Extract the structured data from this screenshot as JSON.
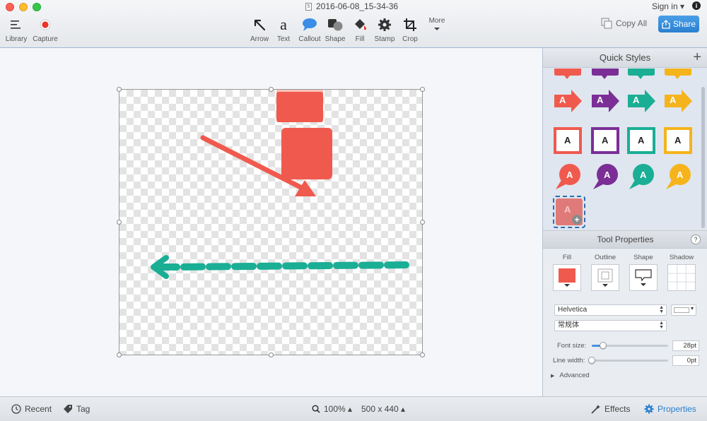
{
  "window": {
    "title": "2016-06-08_15-34-36",
    "signin": "Sign in ▾",
    "doc_glyph": "5"
  },
  "toolbar": {
    "library": "Library",
    "capture": "Capture",
    "tools": {
      "arrow": "Arrow",
      "text": "Text",
      "text_glyph": "a",
      "callout": "Callout",
      "shape": "Shape",
      "fill": "Fill",
      "stamp": "Stamp",
      "crop": "Crop",
      "more": "More"
    },
    "copy_all": "Copy All",
    "share": "Share"
  },
  "quick_styles": {
    "title": "Quick Styles",
    "letter": "A",
    "colors": [
      "#f05a4e",
      "#7b2e96",
      "#1aae95",
      "#f5b41c"
    ]
  },
  "tool_properties": {
    "title": "Tool Properties",
    "help": "?",
    "fill_label": "Fill",
    "outline_label": "Outline",
    "shape_label": "Shape",
    "shadow_label": "Shadow",
    "fill_color": "#f05a4e",
    "font_family": "Helvetica",
    "font_style": "常规体",
    "font_size_label": "Font size:",
    "font_size_value": "28pt",
    "font_size_level": 0.15,
    "line_width_label": "Line width:",
    "line_width_value": "0pt",
    "line_width_level": 0,
    "advanced": "Advanced"
  },
  "bottom": {
    "recent": "Recent",
    "tag": "Tag",
    "zoom": "100% ▴",
    "dimensions": "500 x 440 ▴",
    "effects": "Effects",
    "properties": "Properties"
  },
  "colors": {
    "accent": "#2a7fd0",
    "red": "#f05a4e",
    "teal": "#1aae95"
  }
}
